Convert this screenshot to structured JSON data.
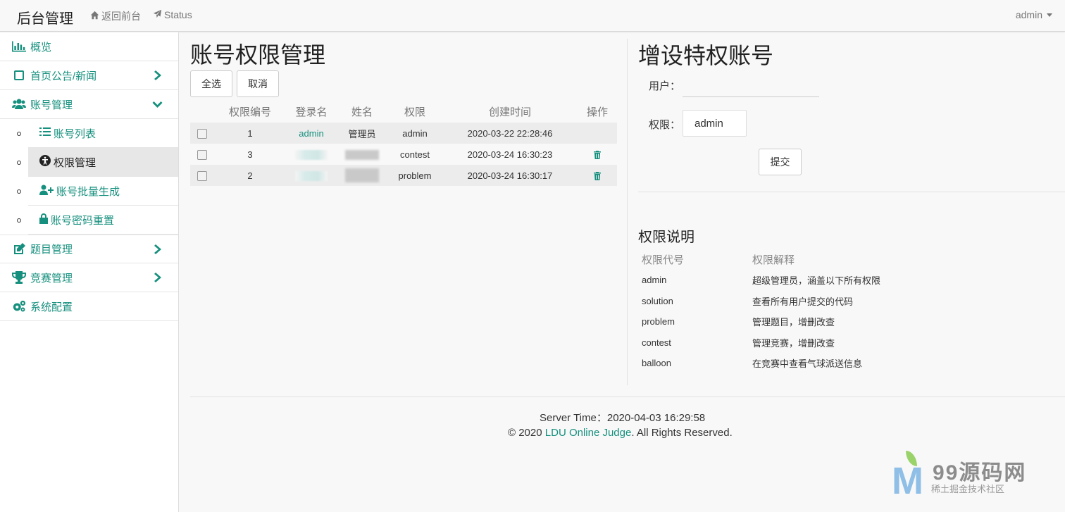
{
  "navbar": {
    "brand": "后台管理",
    "back_link": "返回前台",
    "status_link": "Status",
    "user": "admin"
  },
  "sidebar": {
    "items": [
      {
        "label": "概览",
        "icon": "bar-chart-icon"
      },
      {
        "label": "首页公告/新闻",
        "icon": "square-icon"
      },
      {
        "label": "账号管理",
        "icon": "users-icon"
      }
    ],
    "subitems": [
      {
        "label": "账号列表",
        "icon": "list-icon"
      },
      {
        "label": "权限管理",
        "icon": "accessibility-icon"
      },
      {
        "label": "账号批量生成",
        "icon": "user-plus-icon"
      },
      {
        "label": "账号密码重置",
        "icon": "lock-icon"
      }
    ],
    "items_after": [
      {
        "label": "题目管理",
        "icon": "edit-icon"
      },
      {
        "label": "竞赛管理",
        "icon": "trophy-icon"
      },
      {
        "label": "系统配置",
        "icon": "gears-icon"
      }
    ]
  },
  "main": {
    "title": "账号权限管理",
    "select_all_button": "全选",
    "cancel_button": "取消",
    "table": {
      "headers": [
        "权限编号",
        "登录名",
        "姓名",
        "权限",
        "创建时间",
        "操作"
      ],
      "rows": [
        {
          "id": "1",
          "login": "admin",
          "name": "管理员",
          "privilege": "admin",
          "created": "2020-03-22 22:28:46"
        },
        {
          "id": "3",
          "login": "",
          "name": "",
          "privilege": "contest",
          "created": "2020-03-24 16:30:23"
        },
        {
          "id": "2",
          "login": "",
          "name": "",
          "privilege": "problem",
          "created": "2020-03-24 16:30:17"
        }
      ]
    }
  },
  "add_form": {
    "title": "增设特权账号",
    "user_label": "用户：",
    "user_value": "",
    "privilege_label": "权限：",
    "privilege_selected": "admin",
    "submit_button": "提交"
  },
  "explanation": {
    "title": "权限说明",
    "headers": [
      "权限代号",
      "权限解释"
    ],
    "rows": [
      {
        "code": "admin",
        "desc": "超级管理员，涵盖以下所有权限"
      },
      {
        "code": "solution",
        "desc": "查看所有用户提交的代码"
      },
      {
        "code": "problem",
        "desc": "管理题目，增删改查"
      },
      {
        "code": "contest",
        "desc": "管理竞赛，增删改查"
      },
      {
        "code": "balloon",
        "desc": "在竞赛中查看气球派送信息"
      }
    ]
  },
  "footer": {
    "server_time_label": "Server Time：",
    "server_time": "2020-04-03 16:29:58",
    "copyright_prefix": "© 2020 ",
    "site_name": "LDU Online Judge",
    "copyright_suffix": ". All Rights Reserved."
  },
  "watermark": {
    "logo_letter": "M",
    "text": "99源码网",
    "sub": "稀土掘金技术社区"
  },
  "colors": {
    "accent": "#16907e",
    "background": "#f8f8f8"
  }
}
